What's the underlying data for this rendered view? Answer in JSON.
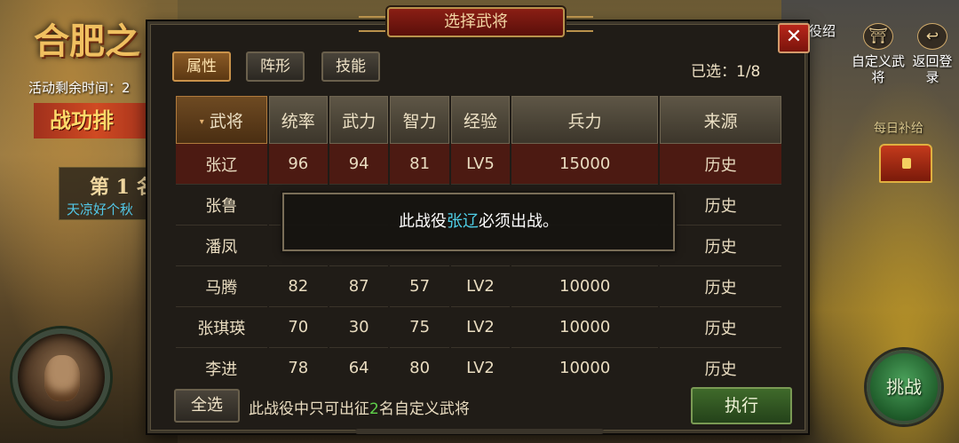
{
  "background": {
    "title": "合肥之",
    "timer_label": "活动剩余时间：2",
    "rank_banner": "战功排",
    "rank_position": "第 1 名",
    "rank_player": "天凉好个秋"
  },
  "side_buttons": {
    "intro": "役绍",
    "custom_general": "自定义武将",
    "back": "返回登录",
    "daily_reward": "每日补给",
    "challenge": "挑战"
  },
  "dialog": {
    "title": "选择武将",
    "close": "✕",
    "tabs": [
      {
        "label": "属性",
        "active": true
      },
      {
        "label": "阵形",
        "active": false
      },
      {
        "label": "技能",
        "active": false
      }
    ],
    "selected": "已选：1/8",
    "columns": [
      "武将",
      "统率",
      "武力",
      "智力",
      "经验",
      "兵力",
      "来源"
    ],
    "sort_arrow": "▾",
    "rows": [
      [
        "张辽",
        "96",
        "94",
        "81",
        "LV5",
        "15000",
        "历史"
      ],
      [
        "张鲁",
        "",
        "",
        "",
        "",
        "",
        "历史"
      ],
      [
        "潘凤",
        "",
        "",
        "",
        "",
        "",
        "历史"
      ],
      [
        "马腾",
        "82",
        "87",
        "57",
        "LV2",
        "10000",
        "历史"
      ],
      [
        "张琪瑛",
        "70",
        "30",
        "75",
        "LV2",
        "10000",
        "历史"
      ],
      [
        "李进",
        "78",
        "64",
        "80",
        "LV2",
        "10000",
        "历史"
      ]
    ],
    "toast": {
      "prefix": "此战役",
      "name": "张辽",
      "suffix": "必须出战。"
    },
    "footer": {
      "select_all": "全选",
      "note_prefix": "此战役中只可出征",
      "note_count": "2",
      "note_suffix": "名自定义武将",
      "execute": "执行"
    }
  },
  "colors": {
    "accent_cyan": "#4fd0e8",
    "accent_green": "#5fd24a",
    "highlight_row": "#4c1a12",
    "header_red": "#8a1e14"
  }
}
